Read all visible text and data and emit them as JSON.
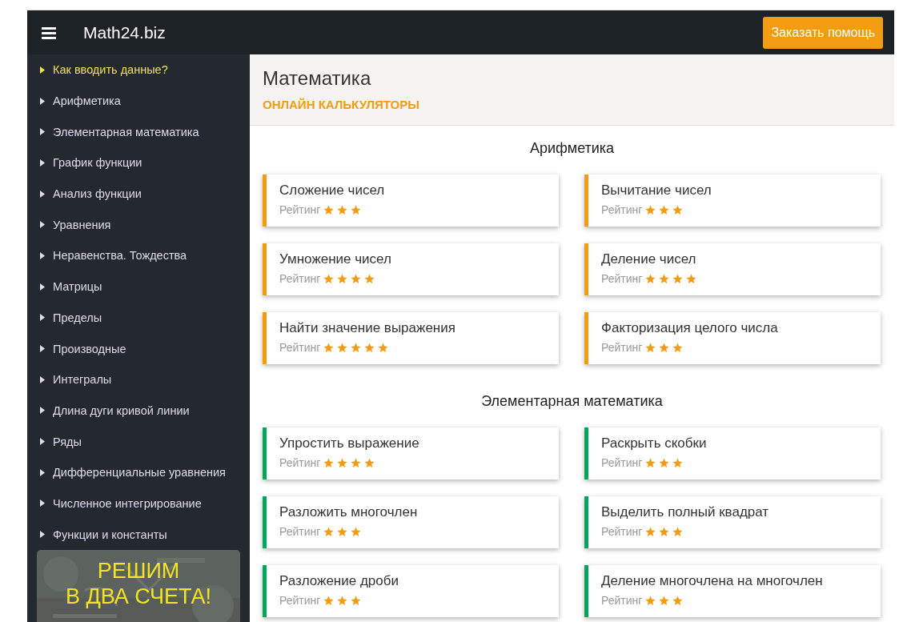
{
  "header": {
    "brand": "Math24.biz",
    "order_button": "Заказать помощь"
  },
  "sidebar": {
    "items": [
      {
        "label": "Как вводить данные?",
        "selected": true
      },
      {
        "label": "Арифметика",
        "selected": false
      },
      {
        "label": "Элементарная математика",
        "selected": false
      },
      {
        "label": "График функции",
        "selected": false
      },
      {
        "label": "Анализ функции",
        "selected": false
      },
      {
        "label": "Уравнения",
        "selected": false
      },
      {
        "label": "Неравенства. Тождества",
        "selected": false
      },
      {
        "label": "Матрицы",
        "selected": false
      },
      {
        "label": "Пределы",
        "selected": false
      },
      {
        "label": "Производные",
        "selected": false
      },
      {
        "label": "Интегралы",
        "selected": false
      },
      {
        "label": "Длина дуги кривой линии",
        "selected": false
      },
      {
        "label": "Ряды",
        "selected": false
      },
      {
        "label": "Дифференциальные уравнения",
        "selected": false
      },
      {
        "label": "Численное интегрирование",
        "selected": false
      },
      {
        "label": "Функции и константы",
        "selected": false
      }
    ],
    "banner": {
      "lines": [
        "РЕШИМ",
        "В ДВА СЧЕТА!"
      ]
    }
  },
  "page": {
    "title": "Математика",
    "subtitle": "ОНЛАЙН КАЛЬКУЛЯТОРЫ"
  },
  "sections": [
    {
      "title": "Арифметика",
      "color": "#f39c12",
      "cards": [
        {
          "title": "Сложение чисел",
          "rating_label": "Рейтинг",
          "stars": 3
        },
        {
          "title": "Вычитание чисел",
          "rating_label": "Рейтинг",
          "stars": 3
        },
        {
          "title": "Умножение чисел",
          "rating_label": "Рейтинг",
          "stars": 4
        },
        {
          "title": "Деление чисел",
          "rating_label": "Рейтинг",
          "stars": 4
        },
        {
          "title": "Найти значение выражения",
          "rating_label": "Рейтинг",
          "stars": 5
        },
        {
          "title": "Факторизация целого числа",
          "rating_label": "Рейтинг",
          "stars": 3
        }
      ]
    },
    {
      "title": "Элементарная математика",
      "color": "#00a65a",
      "cards": [
        {
          "title": "Упростить выражение",
          "rating_label": "Рейтинг",
          "stars": 4
        },
        {
          "title": "Раскрыть скобки",
          "rating_label": "Рейтинг",
          "stars": 3
        },
        {
          "title": "Разложить многочлен",
          "rating_label": "Рейтинг",
          "stars": 3
        },
        {
          "title": "Выделить полный квадрат",
          "rating_label": "Рейтинг",
          "stars": 3
        },
        {
          "title": "Разложение дроби",
          "rating_label": "Рейтинг",
          "stars": 3
        },
        {
          "title": "Деление многочлена на многочлен",
          "rating_label": "Рейтинг",
          "stars": 3
        }
      ]
    }
  ]
}
